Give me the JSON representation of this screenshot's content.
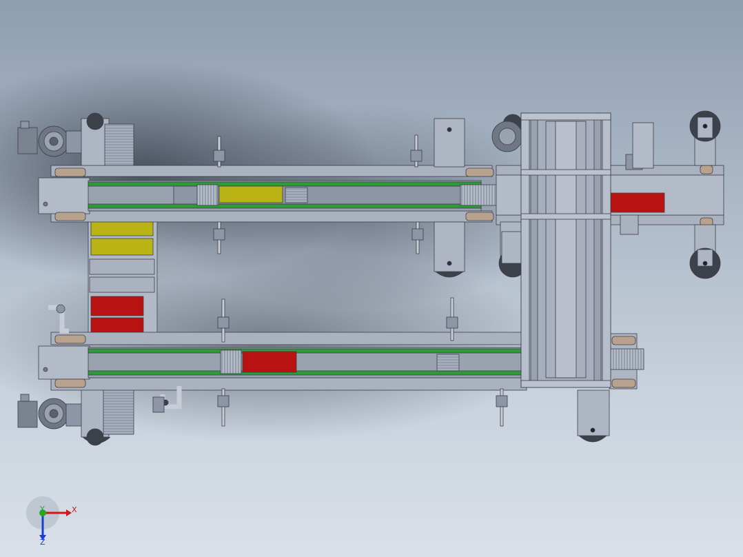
{
  "app": {
    "view": "cad-model-viewport"
  },
  "triad": {
    "x_label": "X",
    "y_label": "Y",
    "z_label": "Z"
  },
  "colors": {
    "frame": "#a7afbf",
    "frame_dark": "#8d95a6",
    "belt_green": "#2f9a3a",
    "label_yellow": "#b9b315",
    "label_red": "#b81212",
    "motor": "#6f7684",
    "axis_x": "#d01818",
    "axis_y": "#22aa22",
    "axis_z": "#1a3fd0"
  }
}
